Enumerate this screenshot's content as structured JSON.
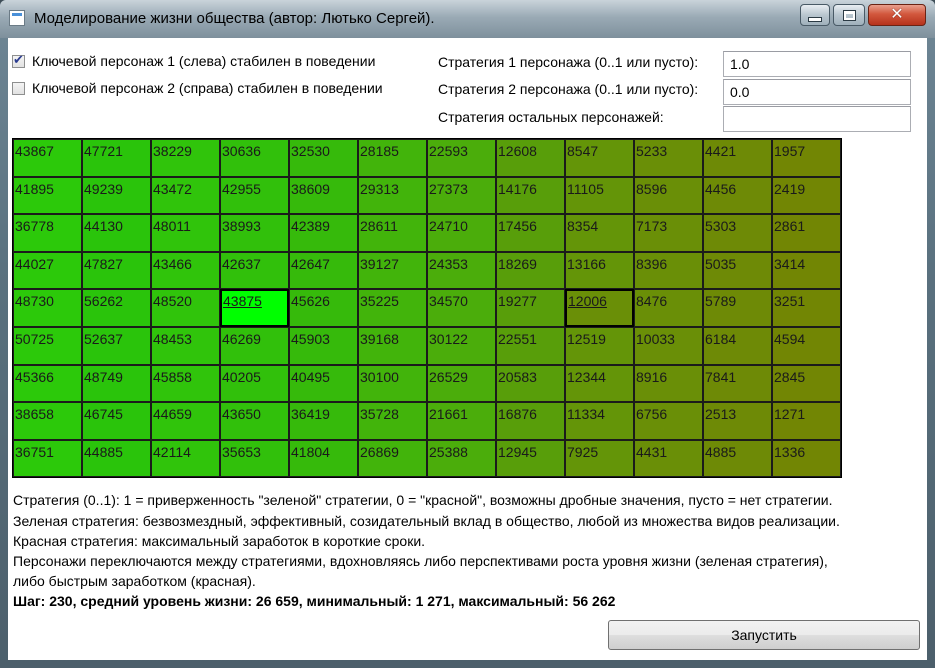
{
  "window": {
    "title": "Моделирование жизни общества (автор: Лютько Сергей)."
  },
  "controls": {
    "checkbox1": {
      "label": "Ключевой персонаж 1 (слева) стабилен в поведении",
      "checked": true
    },
    "checkbox2": {
      "label": "Ключевой персонаж 2 (справа) стабилен в поведении",
      "checked": false
    },
    "strategy1": {
      "label": "Стратегия 1 персонажа (0..1 или пусто):",
      "value": "1.0"
    },
    "strategy2": {
      "label": "Стратегия 2 персонажа (0..1 или пусто):",
      "value": "0.0"
    },
    "strategy_others": {
      "label": "Стратегия остальных персонажей:",
      "value": ""
    }
  },
  "grid": {
    "rows": [
      [
        "43867",
        "47721",
        "38229",
        "30636",
        "32530",
        "28185",
        "22593",
        "12608",
        "8547",
        "5233",
        "4421",
        "1957"
      ],
      [
        "41895",
        "49239",
        "43472",
        "42955",
        "38609",
        "29313",
        "27373",
        "14176",
        "11105",
        "8596",
        "4456",
        "2419"
      ],
      [
        "36778",
        "44130",
        "48011",
        "38993",
        "42389",
        "28611",
        "24710",
        "17456",
        "8354",
        "7173",
        "5303",
        "2861"
      ],
      [
        "44027",
        "47827",
        "43466",
        "42637",
        "42647",
        "39127",
        "24353",
        "18269",
        "13166",
        "8396",
        "5035",
        "3414"
      ],
      [
        "48730",
        "56262",
        "48520",
        "43875",
        "45626",
        "35225",
        "34570",
        "19277",
        "12006",
        "8476",
        "5789",
        "3251"
      ],
      [
        "50725",
        "52637",
        "48453",
        "46269",
        "45903",
        "39168",
        "30122",
        "22551",
        "12519",
        "10033",
        "6184",
        "4594"
      ],
      [
        "45366",
        "48749",
        "45858",
        "40205",
        "40495",
        "30100",
        "26529",
        "20583",
        "12344",
        "8916",
        "7841",
        "2845"
      ],
      [
        "38658",
        "46745",
        "44659",
        "43650",
        "36419",
        "35728",
        "21661",
        "16876",
        "11334",
        "6756",
        "2513",
        "1271"
      ],
      [
        "36751",
        "44885",
        "42114",
        "35653",
        "41804",
        "26869",
        "25388",
        "12945",
        "7925",
        "4431",
        "4885",
        "1336"
      ]
    ],
    "column_colors": [
      "#2cc90a",
      "#2ac40b",
      "#30c40b",
      "#31c00b",
      "#36ba0b",
      "#42b40b",
      "#4bad0b",
      "#589e0a",
      "#649508",
      "#6a8f07",
      "#6e8a06",
      "#728604"
    ],
    "key_cell_1": {
      "row": 4,
      "col": 3,
      "color": "#00ff00"
    },
    "key_cell_2": {
      "row": 4,
      "col": 8,
      "color": "#6a8f07"
    }
  },
  "info": {
    "line1": "Стратегия (0..1): 1 = приверженность \"зеленой\" стратегии, 0 = \"красной\", возможны дробные значения, пусто = нет стратегии.",
    "line2": "Зеленая стратегия: безвозмездный, эффективный, созидательный вклад в общество, любой из множества видов реализации.",
    "line3": "Красная стратегия: максимальный заработок в короткие сроки.",
    "line4": "Персонажи переключаются между стратегиями, вдохновляясь либо перспективами роста уровня жизни (зеленая стратегия),",
    "line5": "либо быстрым заработком (красная).",
    "status": "Шаг: 230, средний уровень жизни: 26 659, минимальный: 1 271, максимальный: 56 262"
  },
  "run_button_label": "Запустить"
}
